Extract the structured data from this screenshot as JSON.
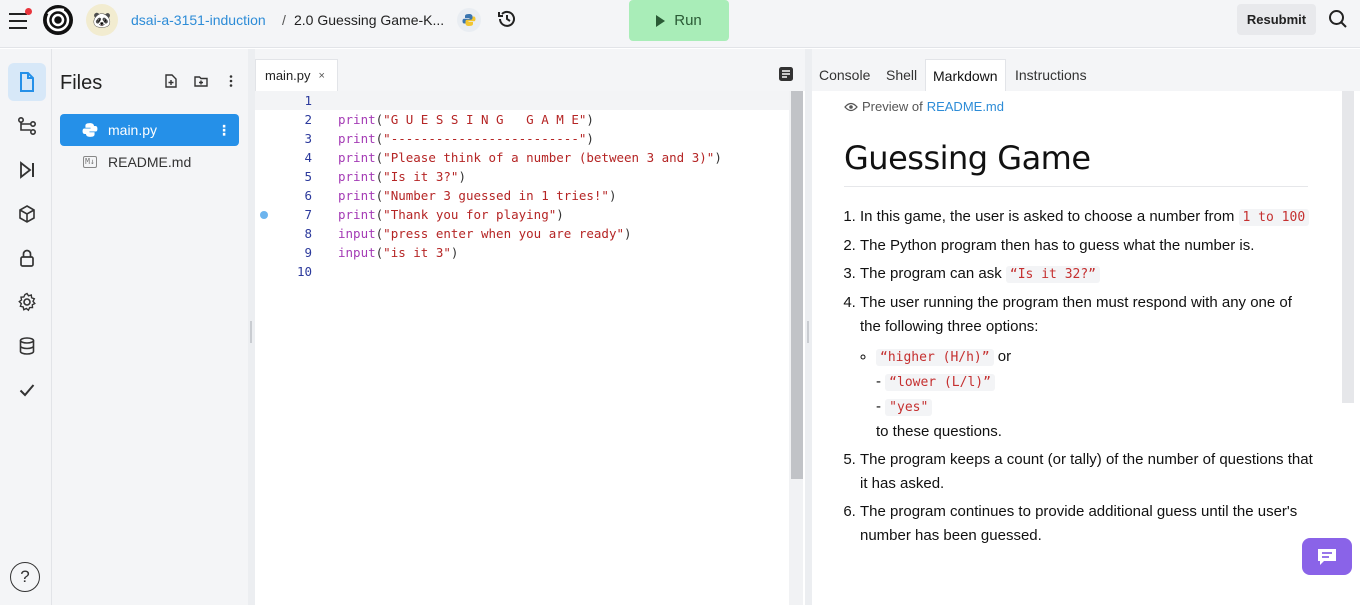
{
  "topbar": {
    "repl_owner": "dsai-a-3151-induction",
    "separator": "/",
    "repl_title": "2.0 Guessing Game-K...",
    "run_label": "Run",
    "resubmit_label": "Resubmit"
  },
  "files": {
    "title": "Files",
    "items": [
      {
        "name": "main.py",
        "icon": "python-icon"
      },
      {
        "name": "README.md",
        "icon": "markdown-icon"
      }
    ]
  },
  "editor": {
    "tab_label": "main.py",
    "tab_close": "×",
    "lines": [
      {
        "n": "1",
        "fn": "",
        "str": ""
      },
      {
        "n": "2",
        "fn": "print",
        "str": "\"G U E S S I N G   G A M E\""
      },
      {
        "n": "3",
        "fn": "print",
        "str": "\"-------------------------\""
      },
      {
        "n": "4",
        "fn": "print",
        "str": "\"Please think of a number (between 3 and 3)\""
      },
      {
        "n": "5",
        "fn": "print",
        "str": "\"Is it 3?\""
      },
      {
        "n": "6",
        "fn": "print",
        "str": "\"Number 3 guessed in 1 tries!\""
      },
      {
        "n": "7",
        "fn": "print",
        "str": "\"Thank you for playing\""
      },
      {
        "n": "8",
        "fn": "input",
        "str": "\"press enter when you are ready\""
      },
      {
        "n": "9",
        "fn": "input",
        "str": "\"is it 3\""
      },
      {
        "n": "10",
        "fn": "",
        "str": ""
      }
    ]
  },
  "right_tabs": [
    "Console",
    "Shell",
    "Markdown",
    "Instructions"
  ],
  "markdown": {
    "preview_prefix": "Preview of",
    "preview_file": "README.md",
    "heading": "Guessing Game",
    "item1_text": "In this game, the user is asked to choose a number from ",
    "item1_code": "1 to 100",
    "item2_text": "The Python program then has to guess what the number is.",
    "item3_text": "The program can ask ",
    "item3_code": "“Is it 32?”",
    "item4_text": "The user running the program then must respond with any one of the following three options:",
    "opt1_code": "“higher (H/h)”",
    "opt1_suffix": " or",
    "opt_dash": "- ",
    "opt2_code": "“lower (L/l)”",
    "opt3_code": "\"yes\"",
    "opt_tail": "to these questions.",
    "item5_text": "The program keeps a count (or tally) of the number of questions that it has asked.",
    "item6_text": "The program continues to provide additional guess until the user's number has been guessed."
  },
  "help_label": "?"
}
